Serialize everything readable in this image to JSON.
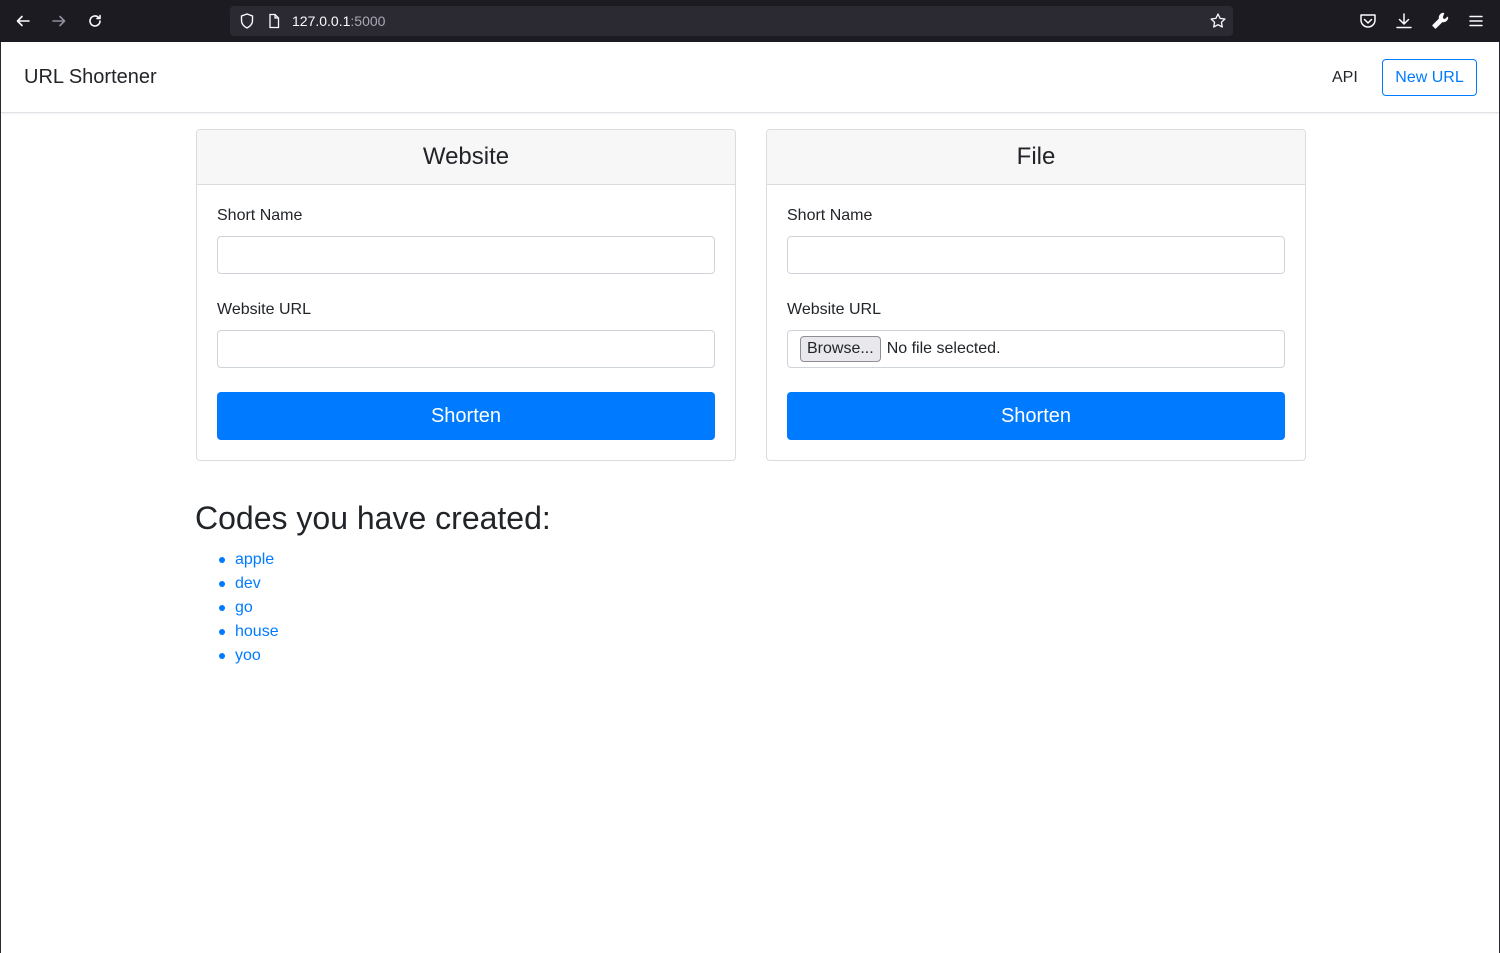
{
  "browser": {
    "url_host": "127.0.0.1",
    "url_port": ":5000"
  },
  "navbar": {
    "brand": "URL Shortener",
    "api_link": "API",
    "new_url_button": "New URL"
  },
  "website_card": {
    "title": "Website",
    "short_name_label": "Short Name",
    "short_name_value": "",
    "url_label": "Website URL",
    "url_value": "",
    "submit_label": "Shorten"
  },
  "file_card": {
    "title": "File",
    "short_name_label": "Short Name",
    "short_name_value": "",
    "url_label": "Website URL",
    "browse_label": "Browse...",
    "file_status": "No file selected.",
    "submit_label": "Shorten"
  },
  "codes": {
    "title": "Codes you have created:",
    "items": [
      "apple",
      "dev",
      "go",
      "house",
      "yoo"
    ]
  },
  "colors": {
    "primary": "#007bff",
    "chrome_bg": "#1c1b22",
    "urlbar_bg": "#2b2a33"
  }
}
